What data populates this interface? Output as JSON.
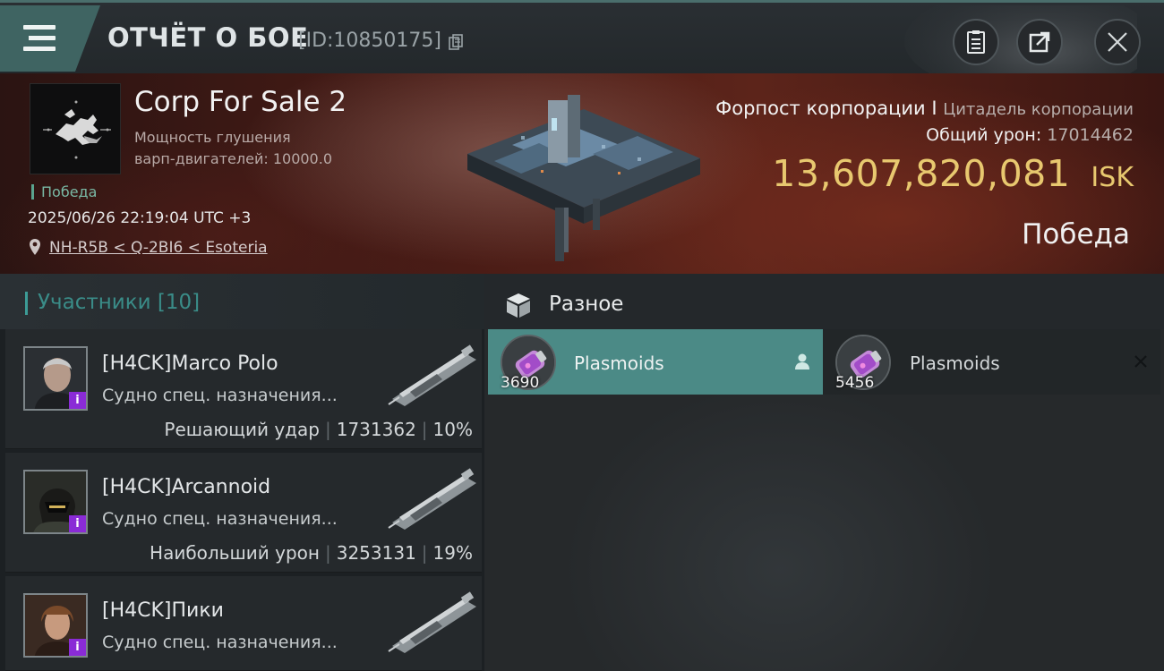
{
  "header": {
    "title": "ОТЧЁТ О БОЕ",
    "battle_id": "[ID:10850175]"
  },
  "banner": {
    "corp_name": "Corp For Sale 2",
    "warp_line1": "Мощность глушения",
    "warp_line2": "варп-двигателей: 10000.0",
    "result_tag": "Победа",
    "datetime": "2025/06/26 22:19:04 UTC +3",
    "location": "NH-R5B < Q-2BI6 < Esoteria",
    "ship_name": "Форпост корпорации I",
    "ship_class": "Цитадель корпорации",
    "total_damage_label": "Общий урон:",
    "total_damage_value": "17014462",
    "isk_amount": "13,607,820,081",
    "isk_currency": "ISK",
    "outcome": "Победа"
  },
  "participants": {
    "header": "Участники [10]",
    "rows": [
      {
        "name": "[H4CK]Marco Polo",
        "ship": "Судно спец. назначения...",
        "role": "Решающий удар",
        "damage": "1731362",
        "percent": "10%"
      },
      {
        "name": "[H4CK]Arcannoid",
        "ship": "Судно спец. назначения...",
        "role": "Наибольший урон",
        "damage": "3253131",
        "percent": "19%"
      },
      {
        "name": "[H4CK]Пики",
        "ship": "Судно спец. назначения...",
        "role": "",
        "damage": "",
        "percent": ""
      }
    ],
    "badge": "i"
  },
  "misc": {
    "title": "Разное",
    "items": [
      {
        "name": "Plasmoids",
        "qty": "3690"
      },
      {
        "name": "Plasmoids",
        "qty": "5456"
      }
    ]
  },
  "colors": {
    "accent_teal": "#3c9b96",
    "selected_item": "#4b8a86",
    "isk_gold": "#e8c86f",
    "victory_green": "#79b8a4",
    "badge_purple": "#8a2bd6"
  },
  "icons": [
    "menu-icon",
    "copy-icon",
    "report-icon",
    "share-icon",
    "close-icon",
    "location-pin-icon",
    "box-icon",
    "person-icon",
    "x-icon"
  ]
}
